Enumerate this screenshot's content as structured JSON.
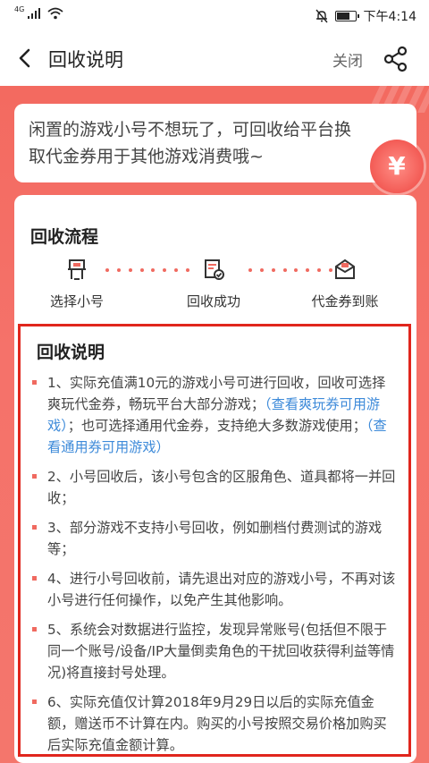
{
  "status_bar": {
    "network": "4G",
    "time": "下午4:14"
  },
  "nav": {
    "title": "回收说明",
    "close_label": "关闭"
  },
  "intro": {
    "text_line1": "闲置的游戏小号不想玩了，可回收给平台换",
    "text_line2": "取代金券用于其他游戏消费哦~",
    "coin_symbol": "¥"
  },
  "flow": {
    "title": "回收流程",
    "steps": [
      {
        "label": "选择小号",
        "icon": "select-account-icon"
      },
      {
        "label": "回收成功",
        "icon": "recycle-success-icon"
      },
      {
        "label": "代金券到账",
        "icon": "voucher-received-icon"
      }
    ]
  },
  "description": {
    "title": "回收说明",
    "item1_prefix": "1、实际充值满10元的游戏小号可进行回收，回收可选择爽玩代金券，畅玩平台大部分游戏；",
    "item1_link1": "（查看爽玩券可用游戏）",
    "item1_middle": "；也可选择通用代金券，支持绝大多数游戏使用；",
    "item1_link2": "（查看通用券可用游戏）",
    "item2": "2、小号回收后，该小号包含的区服角色、道具都将一并回收；",
    "item3": "3、部分游戏不支持小号回收，例如删档付费测试的游戏等；",
    "item4": "4、进行小号回收前，请先退出对应的游戏小号，不再对该小号进行任何操作，以免产生其他影响。",
    "item5": "5、系统会对数据进行监控，发现异常账号(包括但不限于同一个账号/设备/IP大量倒卖角色的干扰回收获得利益等情况)将直接封号处理。",
    "item6": "6、实际充值仅计算2018年9月29日以后的实际充值金额，赠送币不计算在内。购买的小号按照交易价格加购买后实际充值金额计算。"
  },
  "colors": {
    "accent": "#f36a60",
    "highlight_border": "#e0261d",
    "link": "#3d8ad9"
  }
}
